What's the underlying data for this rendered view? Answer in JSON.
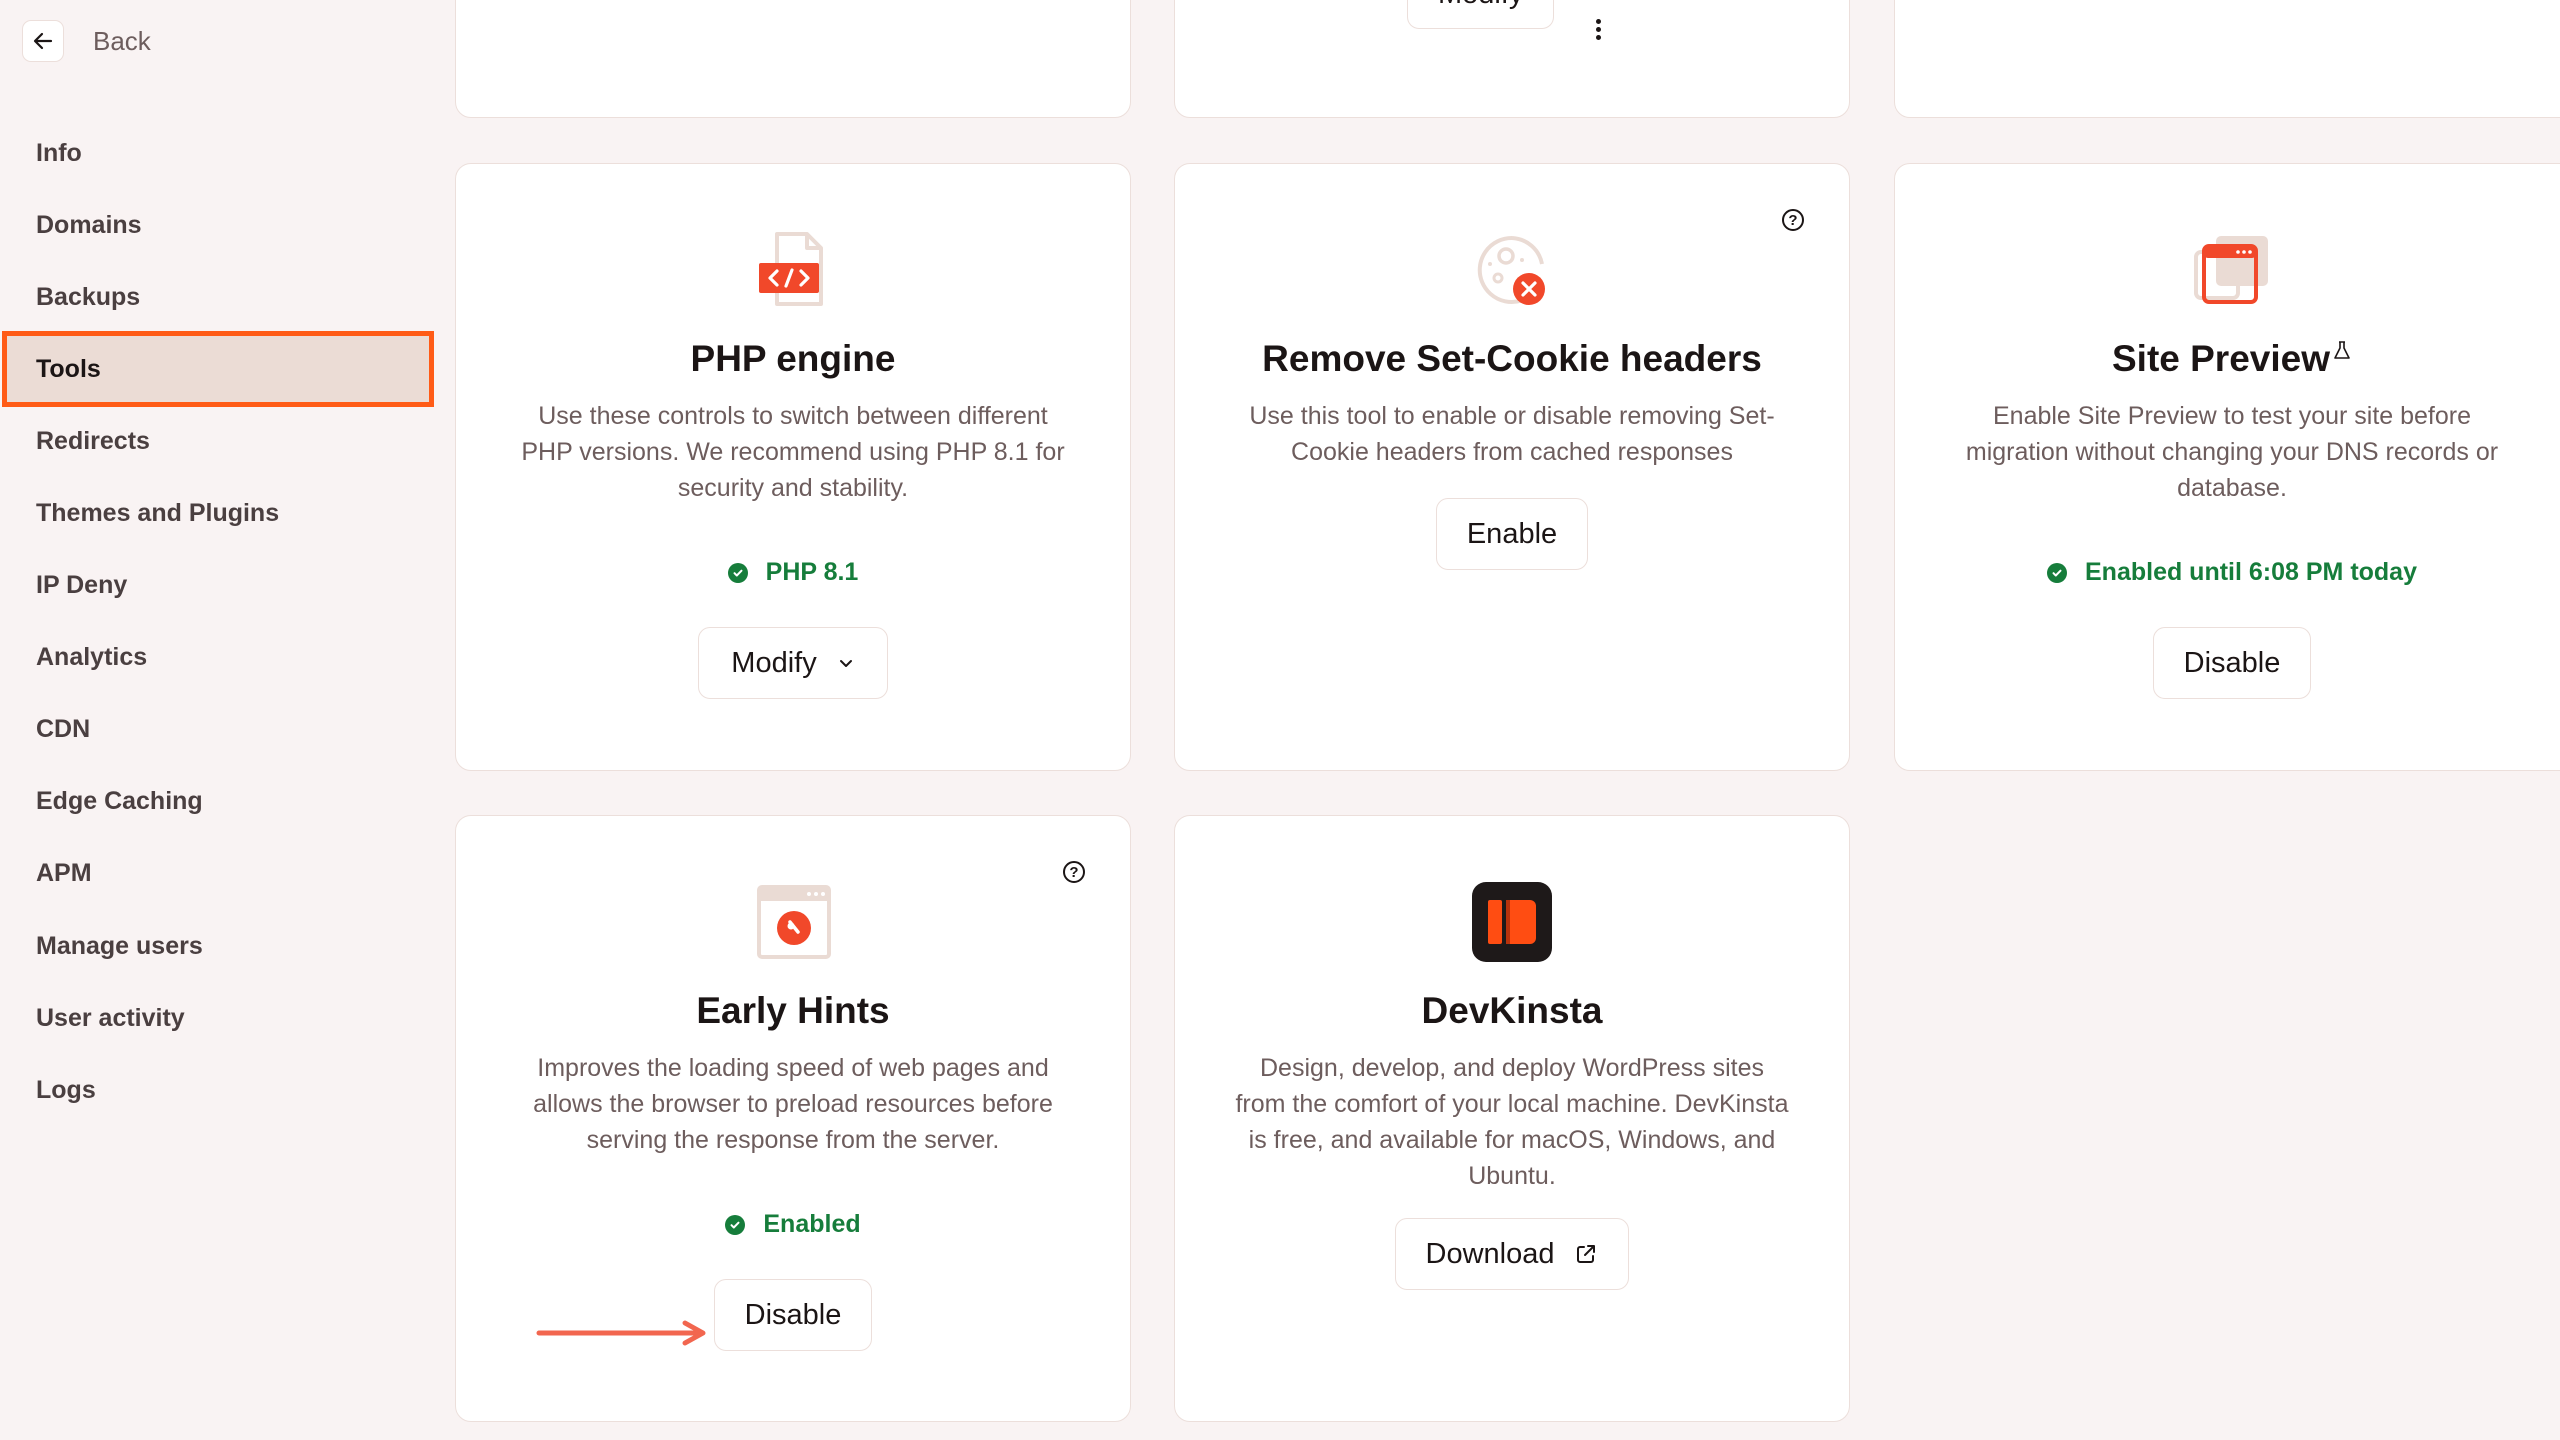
{
  "sidebar": {
    "back_label": "Back",
    "items": [
      {
        "label": "Info"
      },
      {
        "label": "Domains"
      },
      {
        "label": "Backups"
      },
      {
        "label": "Tools",
        "active": true
      },
      {
        "label": "Redirects"
      },
      {
        "label": "Themes and Plugins"
      },
      {
        "label": "IP Deny"
      },
      {
        "label": "Analytics"
      },
      {
        "label": "CDN"
      },
      {
        "label": "Edge Caching"
      },
      {
        "label": "APM"
      },
      {
        "label": "Manage users"
      },
      {
        "label": "User activity"
      },
      {
        "label": "Logs"
      }
    ]
  },
  "top_row": {
    "middle_card": {
      "button_label": "Modify",
      "more_icon": "kebab-menu-icon"
    }
  },
  "cards": {
    "php": {
      "icon": "php-file-code-icon",
      "title": "PHP engine",
      "description": "Use these controls to switch between different PHP versions. We recommend using PHP 8.1 for security and stability.",
      "status": "PHP 8.1",
      "button_label": "Modify"
    },
    "cookie": {
      "icon": "cookie-remove-icon",
      "title": "Remove Set-Cookie headers",
      "description": "Use this tool to enable or disable removing Set-Cookie headers from cached responses",
      "button_label": "Enable"
    },
    "site_preview": {
      "icon": "browser-windows-icon",
      "title": "Site Preview",
      "beta_icon": "flask-icon",
      "description": "Enable Site Preview to test your site before migration without changing your DNS records or database.",
      "status": "Enabled until 6:08 PM today",
      "button_label": "Disable"
    },
    "early_hints": {
      "icon": "early-hints-browser-icon",
      "title": "Early Hints",
      "description": "Improves the loading speed of web pages and allows the browser to preload resources before serving the response from the server.",
      "status": "Enabled",
      "button_label": "Disable"
    },
    "devkinsta": {
      "icon": "devkinsta-logo-icon",
      "title": "DevKinsta",
      "description": "Design, develop, and deploy WordPress sites from the comfort of your local machine. DevKinsta is free, and available for macOS, Windows, and Ubuntu.",
      "button_label": "Download"
    }
  },
  "colors": {
    "accent": "#ff5b16",
    "status_green": "#167d3b",
    "background": "#f9f3f3",
    "annotation_arrow": "#f2664f"
  }
}
